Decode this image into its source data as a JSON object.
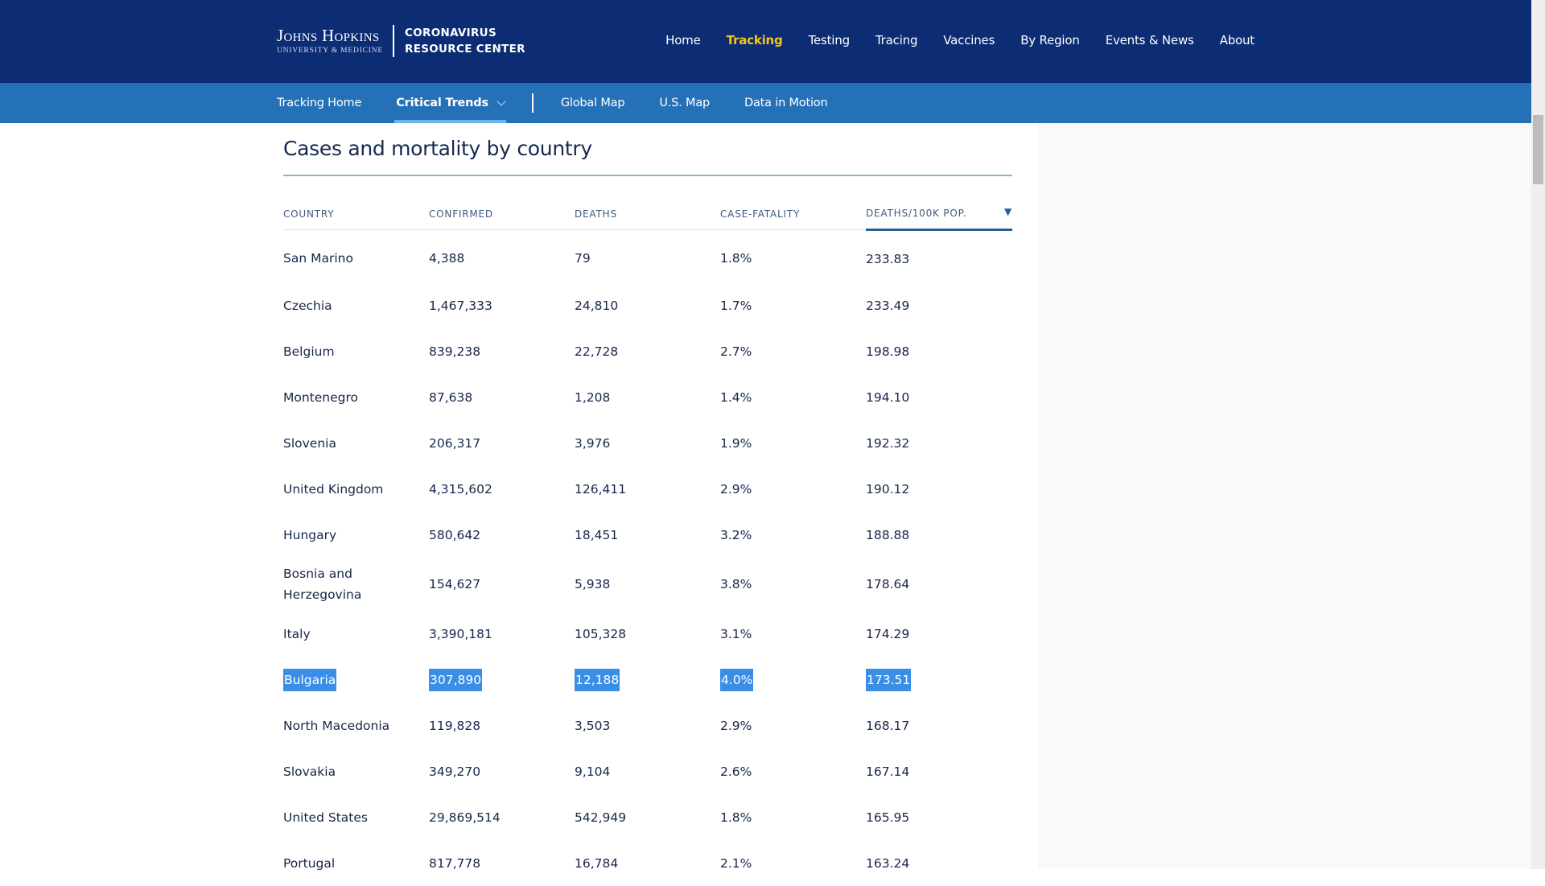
{
  "header": {
    "logo_primary": "Johns Hopkins",
    "logo_secondary": "University & Medicine",
    "site_title_line1": "CORONAVIRUS",
    "site_title_line2": "RESOURCE CENTER",
    "nav": [
      {
        "label": "Home",
        "active": false
      },
      {
        "label": "Tracking",
        "active": true
      },
      {
        "label": "Testing",
        "active": false
      },
      {
        "label": "Tracing",
        "active": false
      },
      {
        "label": "Vaccines",
        "active": false
      },
      {
        "label": "By Region",
        "active": false
      },
      {
        "label": "Events & News",
        "active": false
      },
      {
        "label": "About",
        "active": false
      }
    ]
  },
  "subnav": {
    "items": [
      {
        "label": "Tracking Home",
        "active": false
      },
      {
        "label": "Critical Trends",
        "active": true,
        "dropdown": true
      },
      {
        "label": "Global Map",
        "active": false
      },
      {
        "label": "U.S. Map",
        "active": false
      },
      {
        "label": "Data in Motion",
        "active": false
      }
    ]
  },
  "colors": {
    "topbar": "#0c2c74",
    "subbar": "#2571b8",
    "active_nav": "#f6c518",
    "selection": "#3a8ee6"
  },
  "section": {
    "title": "Cases and mortality by country"
  },
  "table": {
    "columns": [
      "COUNTRY",
      "CONFIRMED",
      "DEATHS",
      "CASE-FATALITY",
      "DEATHS/100K POP."
    ],
    "sorted_column": "DEATHS/100K POP.",
    "sort_direction": "descending",
    "sort_icon": "triangle-down-icon",
    "rows": [
      {
        "country": "San Marino",
        "confirmed": "4,388",
        "deaths": "79",
        "case_fatality": "1.8%",
        "deaths_per_100k": "233.83"
      },
      {
        "country": "Czechia",
        "confirmed": "1,467,333",
        "deaths": "24,810",
        "case_fatality": "1.7%",
        "deaths_per_100k": "233.49"
      },
      {
        "country": "Belgium",
        "confirmed": "839,238",
        "deaths": "22,728",
        "case_fatality": "2.7%",
        "deaths_per_100k": "198.98"
      },
      {
        "country": "Montenegro",
        "confirmed": "87,638",
        "deaths": "1,208",
        "case_fatality": "1.4%",
        "deaths_per_100k": "194.10"
      },
      {
        "country": "Slovenia",
        "confirmed": "206,317",
        "deaths": "3,976",
        "case_fatality": "1.9%",
        "deaths_per_100k": "192.32"
      },
      {
        "country": "United Kingdom",
        "confirmed": "4,315,602",
        "deaths": "126,411",
        "case_fatality": "2.9%",
        "deaths_per_100k": "190.12"
      },
      {
        "country": "Hungary",
        "confirmed": "580,642",
        "deaths": "18,451",
        "case_fatality": "3.2%",
        "deaths_per_100k": "188.88"
      },
      {
        "country": "Bosnia and Herzegovina",
        "confirmed": "154,627",
        "deaths": "5,938",
        "case_fatality": "3.8%",
        "deaths_per_100k": "178.64"
      },
      {
        "country": "Italy",
        "confirmed": "3,390,181",
        "deaths": "105,328",
        "case_fatality": "3.1%",
        "deaths_per_100k": "174.29"
      },
      {
        "country": "Bulgaria",
        "confirmed": "307,890",
        "deaths": "12,188",
        "case_fatality": "4.0%",
        "deaths_per_100k": "173.51",
        "selected": true
      },
      {
        "country": "North Macedonia",
        "confirmed": "119,828",
        "deaths": "3,503",
        "case_fatality": "2.9%",
        "deaths_per_100k": "168.17"
      },
      {
        "country": "Slovakia",
        "confirmed": "349,270",
        "deaths": "9,104",
        "case_fatality": "2.6%",
        "deaths_per_100k": "167.14"
      },
      {
        "country": "United States",
        "confirmed": "29,869,514",
        "deaths": "542,949",
        "case_fatality": "1.8%",
        "deaths_per_100k": "165.95"
      },
      {
        "country": "Portugal",
        "confirmed": "817,778",
        "deaths": "16,784",
        "case_fatality": "2.1%",
        "deaths_per_100k": "163.24"
      }
    ]
  }
}
